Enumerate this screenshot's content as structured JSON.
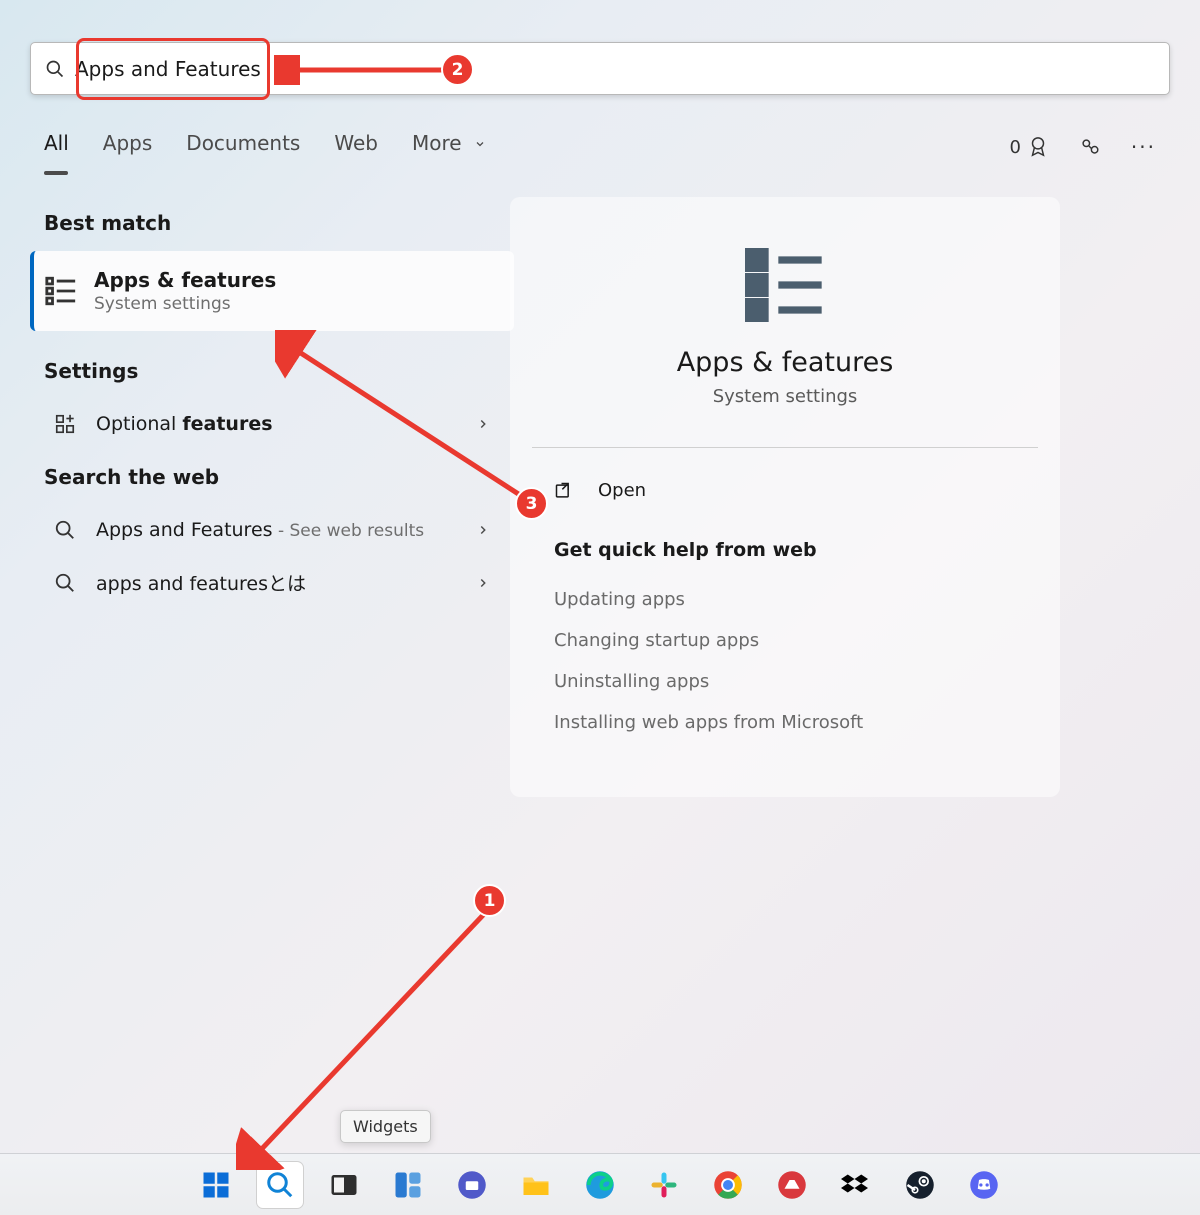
{
  "search": {
    "value": "Apps and Features"
  },
  "tabs": {
    "items": [
      "All",
      "Apps",
      "Documents",
      "Web",
      "More"
    ],
    "activeIndex": 0,
    "rewards_count": "0"
  },
  "left": {
    "best_match_header": "Best match",
    "best_match": {
      "title": "Apps & features",
      "subtitle": "System settings"
    },
    "settings_header": "Settings",
    "settings_item_prefix": "Optional ",
    "settings_item_bold": "features",
    "web_header": "Search the web",
    "web_items": [
      {
        "label": "Apps and Features",
        "suffix": " - See web results"
      },
      {
        "label": "apps and featuresとは",
        "suffix": ""
      }
    ]
  },
  "right": {
    "title": "Apps & features",
    "subtitle": "System settings",
    "open_label": "Open",
    "help_header": "Get quick help from web",
    "help_links": [
      "Updating apps",
      "Changing startup apps",
      "Uninstalling apps",
      "Installing web apps from Microsoft"
    ]
  },
  "tooltip": "Widgets",
  "annotations": {
    "1": "1",
    "2": "2",
    "3": "3"
  }
}
